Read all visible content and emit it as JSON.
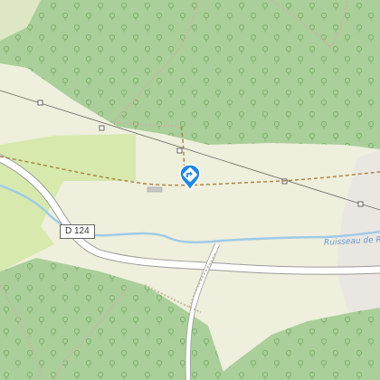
{
  "map": {
    "colors": {
      "background": "#eeefdc",
      "forest": "#aacf9a",
      "forest_light": "#c9e0ad",
      "meadow": "#d7e9ad",
      "built_area": "#eae6e1",
      "road_casing": "#9b9b9b",
      "road_fill": "#ffffff",
      "stream": "#9ecae8",
      "power_line": "#666666",
      "track": "#a9803c",
      "path": "#c9b6a4",
      "marker": "#1e88e5"
    },
    "road_label": "D 124",
    "river_label": "Ruisseau de Re",
    "marker_icon": "turn-direction-icon"
  }
}
